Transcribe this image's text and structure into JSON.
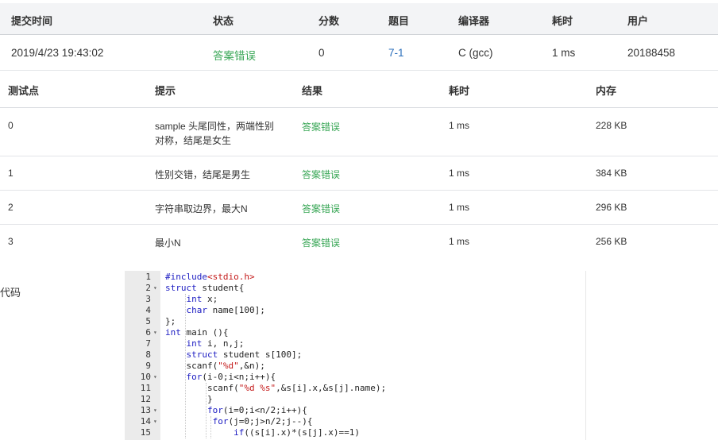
{
  "submission": {
    "headers": [
      "提交时间",
      "状态",
      "分数",
      "题目",
      "编译器",
      "耗时",
      "用户"
    ],
    "row": {
      "time": "2019/4/23 19:43:02",
      "status": "答案错误",
      "score": "0",
      "problem": "7-1",
      "compiler": "C (gcc)",
      "elapsed": "1 ms",
      "user": "20188458"
    }
  },
  "testcases": {
    "headers": [
      "测试点",
      "提示",
      "结果",
      "耗时",
      "内存"
    ],
    "rows": [
      {
        "id": "0",
        "hint": "sample 头尾同性，两端性别对称，结尾是女生",
        "result": "答案错误",
        "time": "1 ms",
        "memory": "228 KB"
      },
      {
        "id": "1",
        "hint": "性别交错，结尾是男生",
        "result": "答案错误",
        "time": "1 ms",
        "memory": "384 KB"
      },
      {
        "id": "2",
        "hint": "字符串取边界，最大N",
        "result": "答案错误",
        "time": "1 ms",
        "memory": "296 KB"
      },
      {
        "id": "3",
        "hint": "最小N",
        "result": "答案错误",
        "time": "1 ms",
        "memory": "256 KB"
      }
    ]
  },
  "code": {
    "label": "代码",
    "lines": [
      {
        "n": "1",
        "fold": false,
        "text": "#include<stdio.h>"
      },
      {
        "n": "2",
        "fold": true,
        "text": "struct student{"
      },
      {
        "n": "3",
        "fold": false,
        "text": "    int x;"
      },
      {
        "n": "4",
        "fold": false,
        "text": "    char name[100];"
      },
      {
        "n": "5",
        "fold": false,
        "text": "};"
      },
      {
        "n": "6",
        "fold": true,
        "text": "int main (){"
      },
      {
        "n": "7",
        "fold": false,
        "text": "    int i, n,j;"
      },
      {
        "n": "8",
        "fold": false,
        "text": "    struct student s[100];"
      },
      {
        "n": "9",
        "fold": false,
        "text": "    scanf(\"%d\",&n);"
      },
      {
        "n": "10",
        "fold": true,
        "text": "    for(i-0;i<n;i++){"
      },
      {
        "n": "11",
        "fold": false,
        "text": "        scanf(\"%d %s\",&s[i].x,&s[j].name);"
      },
      {
        "n": "12",
        "fold": false,
        "text": "        }"
      },
      {
        "n": "13",
        "fold": true,
        "text": "        for(i=0;i<n/2;i++){"
      },
      {
        "n": "14",
        "fold": true,
        "text": "         for(j=0;j>n/2;j--){"
      },
      {
        "n": "15",
        "fold": false,
        "text": "             if((s[i].x)*(s[j].x)==1)"
      }
    ]
  }
}
